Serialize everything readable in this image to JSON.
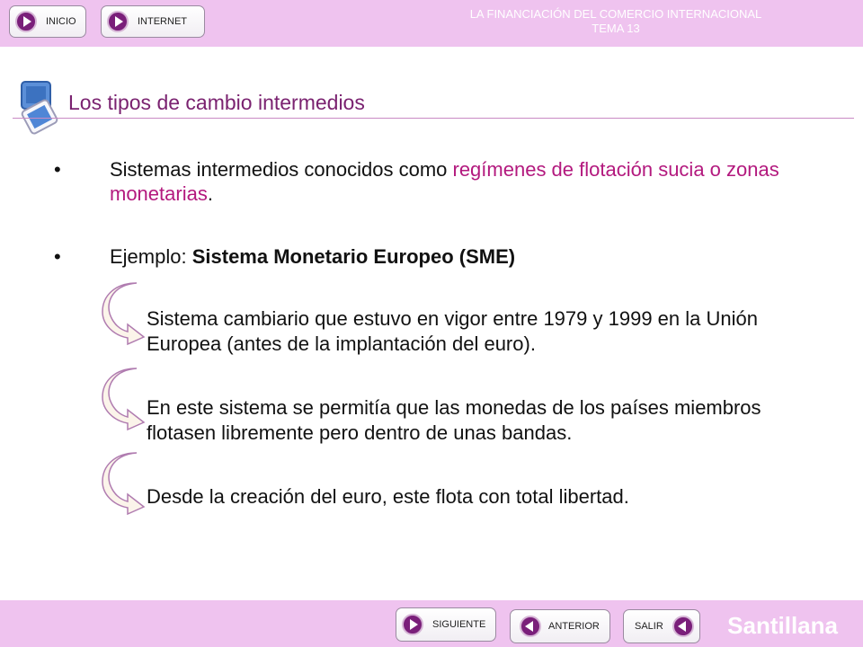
{
  "header": {
    "title_line1": "LA FINANCIACIÓN DEL COMERCIO INTERNACIONAL",
    "title_line2": "TEMA 13",
    "buttons": {
      "inicio": "INICIO",
      "internet": "INTERNET"
    }
  },
  "slide": {
    "title": "Los tipos de cambio intermedios",
    "bullet1": {
      "text_a": "Sistemas intermedios conocidos como ",
      "highlight": "regímenes de flotación sucia o zonas monetarias",
      "text_b": "."
    },
    "bullet2": {
      "prefix": "Ejemplo: ",
      "bold": "Sistema Monetario Europeo (SME)"
    },
    "sub_items": [
      "Sistema cambiario que estuvo en vigor entre 1979 y 1999 en la Unión Europea (antes de la implantación del euro).",
      "En este sistema se permitía que las monedas de los países miembros flotasen libremente pero dentro de unas bandas.",
      "Desde la creación del euro, este flota con total libertad."
    ]
  },
  "footer": {
    "buttons": {
      "siguiente": "SIGUIENTE",
      "anterior": "ANTERIOR",
      "salir": "SALIR"
    },
    "brand": "Santillana"
  },
  "colors": {
    "bar": "#efc3ef",
    "accent": "#7a1f7a",
    "highlight": "#b3197e",
    "title": "#7a2270"
  }
}
